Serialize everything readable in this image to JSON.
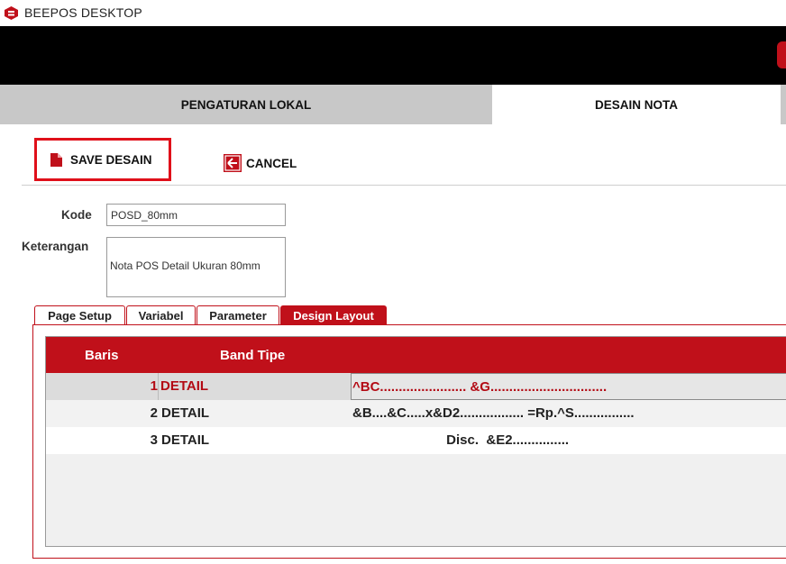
{
  "app": {
    "title": "BEEPOS DESKTOP"
  },
  "tabs": {
    "lokal": "PENGATURAN LOKAL",
    "desain": "DESAIN NOTA"
  },
  "toolbar": {
    "save_label": "SAVE DESAIN",
    "cancel_label": "CANCEL"
  },
  "form": {
    "kode_label": "Kode",
    "kode_value": "POSD_80mm",
    "keterangan_label": "Keterangan",
    "keterangan_value": "Nota POS Detail Ukuran 80mm"
  },
  "subtabs": [
    "Page Setup",
    "Variabel",
    "Parameter",
    "Design Layout"
  ],
  "active_subtab": "Design Layout",
  "grid": {
    "headers": {
      "baris": "Baris",
      "band": "Band Tipe"
    },
    "rows": [
      {
        "no": "1",
        "band": "DETAIL",
        "layout": "^BC....................... &G...............................",
        "selected": true
      },
      {
        "no": "2",
        "band": "DETAIL",
        "layout": "&B....&C.....x&D2................. =Rp.^S................",
        "selected": false
      },
      {
        "no": "3",
        "band": "DETAIL",
        "layout": "                         Disc.  &E2...............",
        "selected": false
      }
    ]
  },
  "colors": {
    "accent": "#c0101a",
    "highlight_border": "#e0101a"
  },
  "icons": {
    "app_logo": "beepos-logo-icon",
    "save": "document-icon",
    "cancel": "arrow-left-icon"
  }
}
